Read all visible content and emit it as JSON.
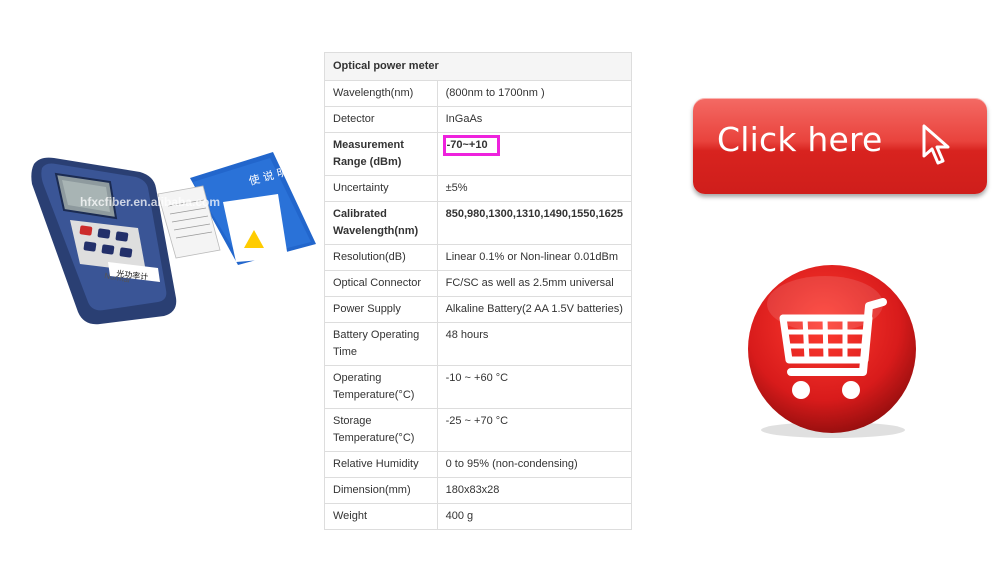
{
  "product": {
    "watermark": "hfxcfiber.en.alibaba.com",
    "device_button": "Normal",
    "device_label": "光功率计",
    "manual_text": "使 说 明"
  },
  "spec_table": {
    "title": "Optical power meter",
    "rows": [
      {
        "key": "Wavelength(nm)",
        "value": "(800nm to 1700nm )",
        "bold": false
      },
      {
        "key": "Detector",
        "value": "InGaAs",
        "bold": false
      },
      {
        "key": "Measurement Range (dBm)",
        "value": "-70~+10",
        "bold": true,
        "highlighted": true
      },
      {
        "key": "Uncertainty",
        "value": "±5%",
        "bold": false
      },
      {
        "key": "Calibrated Wavelength(nm)",
        "value": "850,980,1300,1310,1490,1550,1625",
        "bold": true
      },
      {
        "key": "Resolution(dB)",
        "value": "Linear 0.1% or Non-linear 0.01dBm",
        "bold": false
      },
      {
        "key": "Optical Connector",
        "value": "FC/SC as well as 2.5mm universal",
        "bold": false
      },
      {
        "key": "Power Supply",
        "value": "Alkaline Battery(2 AA 1.5V batteries)",
        "bold": false
      },
      {
        "key": "Battery Operating Time",
        "value": "48 hours",
        "bold": false
      },
      {
        "key": "Operating Temperature(°C)",
        "value": "-10 ~ +60 °C",
        "bold": false
      },
      {
        "key": "Storage Temperature(°C)",
        "value": "-25 ~ +70 °C",
        "bold": false
      },
      {
        "key": "Relative Humidity",
        "value": "0 to 95% (non-condensing)",
        "bold": false
      },
      {
        "key": "Dimension(mm)",
        "value": "180x83x28",
        "bold": false
      },
      {
        "key": "Weight",
        "value": "400 g",
        "bold": false
      }
    ],
    "highlight_color": "#ee22dd"
  },
  "click_button": {
    "label": "Click here",
    "icon": "cursor-arrow-icon",
    "color": "#e53935"
  },
  "cart_button": {
    "icon": "shopping-cart-icon",
    "color": "#d81b1b"
  }
}
